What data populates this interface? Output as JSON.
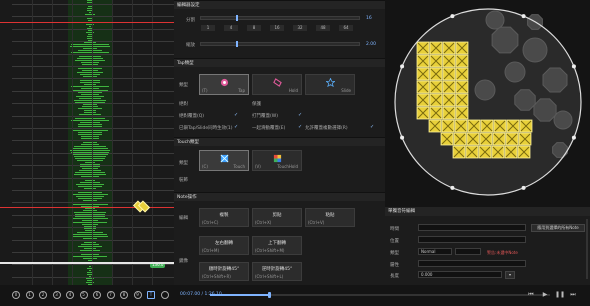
{
  "timeline": {
    "red_markers": [
      "",
      ""
    ],
    "yellow_note_label": "",
    "green_note_label": "136.0",
    "tool_labels": [
      "0",
      "1",
      "2",
      "3",
      "4",
      "5",
      "6",
      "7",
      "8",
      "9",
      "T",
      ""
    ]
  },
  "middle": {
    "grid_section": {
      "title": "編輯器設定",
      "division_label": "分割",
      "division_value": "16",
      "division_ticks": [
        "1",
        "4",
        "8",
        "16",
        "32",
        "48",
        "64"
      ],
      "zoom_label": "縮放",
      "zoom_value": "2.00"
    },
    "tap_section": {
      "title": "Tap類型",
      "type_label": "類型",
      "tiles": [
        {
          "name": "Tap",
          "key": "(T)",
          "icon": "tap"
        },
        {
          "name": "Hold",
          "key": "",
          "icon": "hold"
        },
        {
          "name": "Slide",
          "key": "",
          "icon": "slide"
        }
      ],
      "option_row1_left": "絕對",
      "option_row1_mid": "保護",
      "option_row2_left": "絕對覆蓋(Q)",
      "option_row2_mid": "打鬥覆蓋(W)",
      "option_row3_left": "已鎖Tap/Slide同時生效(1)",
      "option_row3_mid": "一起滑動覆蓋(E)",
      "option_row3_right": "允許覆蓋複數選擇(R)"
    },
    "touch_section": {
      "title": "Touch類型",
      "type_label": "類型",
      "tiles": [
        {
          "name": "Touch",
          "key": "(C)",
          "icon": "touch"
        },
        {
          "name": "TouchHold",
          "key": "(V)",
          "icon": "touchhold"
        }
      ],
      "sub_label": "裝飾"
    },
    "note_ops": {
      "title": "Note操作",
      "edit_label": "編輯",
      "copy_label": "複製",
      "copy_hotkey": "(Ctrl+C)",
      "cut_label": "剪貼",
      "cut_hotkey": "(Ctrl+X)",
      "paste_label": "粘貼",
      "paste_hotkey": "(Ctrl+V)",
      "flip_label": "鏡像",
      "flip_h_label": "左右翻轉",
      "flip_h_hotkey": "(Ctrl+M)",
      "flip_v_label": "上下翻轉",
      "flip_v_hotkey": "(Ctrl+Shift+M)",
      "rot_cw_label": "順時針旋轉45°",
      "rot_cw_hotkey": "(Ctrl+Shift+R)",
      "rot_ccw_label": "逆時針旋轉45°",
      "rot_ccw_hotkey": "(Ctrl+Shift+L)"
    }
  },
  "note_editor": {
    "title": "單獨音符編輯",
    "label_time": "時間",
    "label_position": "位置",
    "label_type": "類型",
    "label_extra": "屬性",
    "label_duration": "長度",
    "type_value": "Normal",
    "duration_value": "0.000",
    "apply_button": "應用到選擇的所有Note",
    "red_warning": "警告:未選中Note"
  },
  "transport": {
    "time": "00:07.00 / 1:26.10",
    "progress": 0.17
  },
  "colors": {
    "accent": "#7fb4ff",
    "note_yellow": "#e8d03a",
    "wave_green": "#3fb53f",
    "marker_red": "#dd3333"
  }
}
